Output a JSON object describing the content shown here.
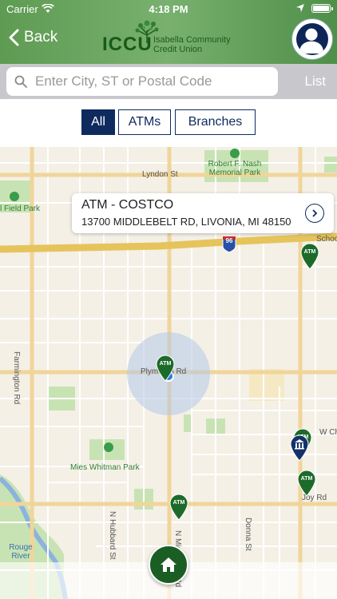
{
  "status_bar": {
    "carrier": "Carrier",
    "time": "4:18 PM"
  },
  "header": {
    "back_label": "Back",
    "logo_abbr": "ICCU",
    "logo_line1": "Isabella Community",
    "logo_line2": "Credit Union",
    "brand_color": "#5e9b52"
  },
  "search": {
    "placeholder": "Enter City, ST or Postal Code",
    "list_label": "List"
  },
  "filters": {
    "all": "All",
    "atms": "ATMs",
    "branches": "Branches",
    "selected": "All",
    "accent": "#0e2a5e"
  },
  "map": {
    "roads": [
      "Lyndon St",
      "Plymouth Rd",
      "Farmington Rd",
      "N Hubbard St",
      "N Middlebelt Rd",
      "Donna St",
      "Joy Rd",
      "School",
      "W Ch"
    ],
    "parks": [
      "Robert F. Nash Memorial Park",
      "l Field Park",
      "Mies Whitman Park",
      "Rouge River"
    ],
    "highway_shield": "96",
    "callout": {
      "title": "ATM - COSTCO",
      "address": "13700 MIDDLEBELT RD, LIVONIA, MI 48150"
    },
    "pin_label": "ATM"
  }
}
